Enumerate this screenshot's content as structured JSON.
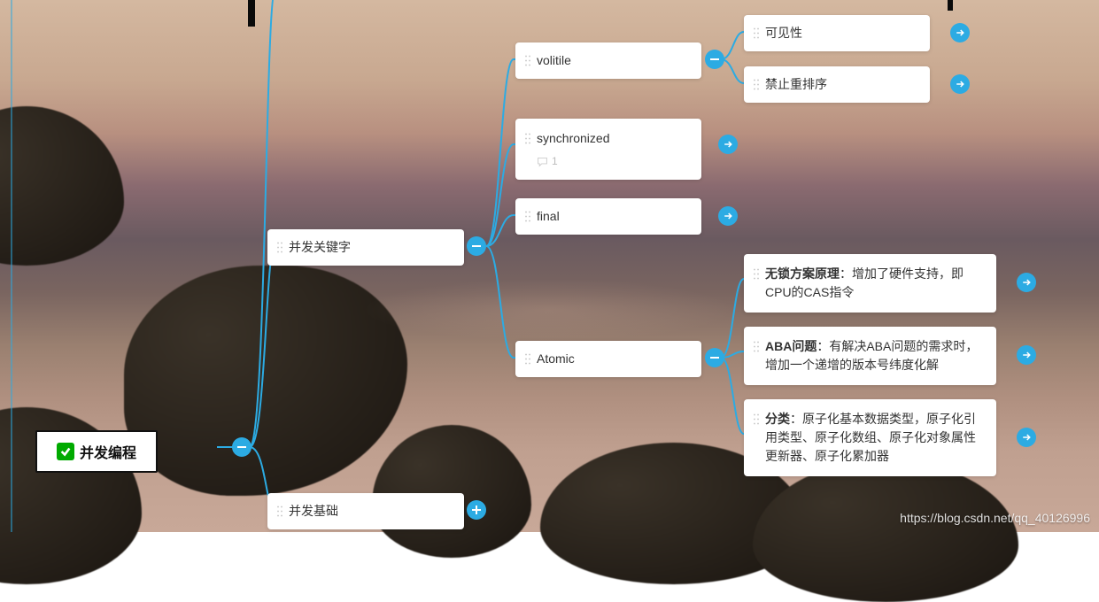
{
  "root": {
    "label": "并发编程"
  },
  "level1": {
    "keywords": {
      "label": "并发关键字"
    },
    "basics": {
      "label": "并发基础"
    }
  },
  "keywords_children": {
    "volitile": {
      "label": "volitile"
    },
    "synchronized": {
      "label": "synchronized",
      "comment_count": "1"
    },
    "final": {
      "label": "final"
    },
    "atomic": {
      "label": "Atomic"
    }
  },
  "volitile_children": {
    "visibility": {
      "label": "可见性"
    },
    "no_reorder": {
      "label": "禁止重排序"
    }
  },
  "atomic_children": {
    "cas": {
      "bold": "无锁方案原理",
      "rest": "：增加了硬件支持，即CPU的CAS指令"
    },
    "aba": {
      "bold": "ABA问题",
      "rest": "：有解决ABA问题的需求时，增加一个递增的版本号纬度化解"
    },
    "category": {
      "bold": "分类",
      "rest": "：原子化基本数据类型，原子化引用类型、原子化数组、原子化对象属性更新器、原子化累加器"
    }
  },
  "watermark": "https://blog.csdn.net/qq_40126996"
}
